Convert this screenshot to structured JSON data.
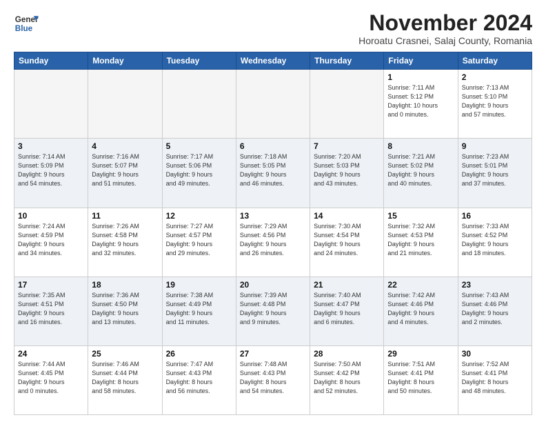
{
  "logo": {
    "line1": "General",
    "line2": "Blue"
  },
  "title": "November 2024",
  "subtitle": "Horoatu Crasnei, Salaj County, Romania",
  "days_of_week": [
    "Sunday",
    "Monday",
    "Tuesday",
    "Wednesday",
    "Thursday",
    "Friday",
    "Saturday"
  ],
  "weeks": [
    [
      {
        "day": "",
        "info": ""
      },
      {
        "day": "",
        "info": ""
      },
      {
        "day": "",
        "info": ""
      },
      {
        "day": "",
        "info": ""
      },
      {
        "day": "",
        "info": ""
      },
      {
        "day": "1",
        "info": "Sunrise: 7:11 AM\nSunset: 5:12 PM\nDaylight: 10 hours\nand 0 minutes."
      },
      {
        "day": "2",
        "info": "Sunrise: 7:13 AM\nSunset: 5:10 PM\nDaylight: 9 hours\nand 57 minutes."
      }
    ],
    [
      {
        "day": "3",
        "info": "Sunrise: 7:14 AM\nSunset: 5:09 PM\nDaylight: 9 hours\nand 54 minutes."
      },
      {
        "day": "4",
        "info": "Sunrise: 7:16 AM\nSunset: 5:07 PM\nDaylight: 9 hours\nand 51 minutes."
      },
      {
        "day": "5",
        "info": "Sunrise: 7:17 AM\nSunset: 5:06 PM\nDaylight: 9 hours\nand 49 minutes."
      },
      {
        "day": "6",
        "info": "Sunrise: 7:18 AM\nSunset: 5:05 PM\nDaylight: 9 hours\nand 46 minutes."
      },
      {
        "day": "7",
        "info": "Sunrise: 7:20 AM\nSunset: 5:03 PM\nDaylight: 9 hours\nand 43 minutes."
      },
      {
        "day": "8",
        "info": "Sunrise: 7:21 AM\nSunset: 5:02 PM\nDaylight: 9 hours\nand 40 minutes."
      },
      {
        "day": "9",
        "info": "Sunrise: 7:23 AM\nSunset: 5:01 PM\nDaylight: 9 hours\nand 37 minutes."
      }
    ],
    [
      {
        "day": "10",
        "info": "Sunrise: 7:24 AM\nSunset: 4:59 PM\nDaylight: 9 hours\nand 34 minutes."
      },
      {
        "day": "11",
        "info": "Sunrise: 7:26 AM\nSunset: 4:58 PM\nDaylight: 9 hours\nand 32 minutes."
      },
      {
        "day": "12",
        "info": "Sunrise: 7:27 AM\nSunset: 4:57 PM\nDaylight: 9 hours\nand 29 minutes."
      },
      {
        "day": "13",
        "info": "Sunrise: 7:29 AM\nSunset: 4:56 PM\nDaylight: 9 hours\nand 26 minutes."
      },
      {
        "day": "14",
        "info": "Sunrise: 7:30 AM\nSunset: 4:54 PM\nDaylight: 9 hours\nand 24 minutes."
      },
      {
        "day": "15",
        "info": "Sunrise: 7:32 AM\nSunset: 4:53 PM\nDaylight: 9 hours\nand 21 minutes."
      },
      {
        "day": "16",
        "info": "Sunrise: 7:33 AM\nSunset: 4:52 PM\nDaylight: 9 hours\nand 18 minutes."
      }
    ],
    [
      {
        "day": "17",
        "info": "Sunrise: 7:35 AM\nSunset: 4:51 PM\nDaylight: 9 hours\nand 16 minutes."
      },
      {
        "day": "18",
        "info": "Sunrise: 7:36 AM\nSunset: 4:50 PM\nDaylight: 9 hours\nand 13 minutes."
      },
      {
        "day": "19",
        "info": "Sunrise: 7:38 AM\nSunset: 4:49 PM\nDaylight: 9 hours\nand 11 minutes."
      },
      {
        "day": "20",
        "info": "Sunrise: 7:39 AM\nSunset: 4:48 PM\nDaylight: 9 hours\nand 9 minutes."
      },
      {
        "day": "21",
        "info": "Sunrise: 7:40 AM\nSunset: 4:47 PM\nDaylight: 9 hours\nand 6 minutes."
      },
      {
        "day": "22",
        "info": "Sunrise: 7:42 AM\nSunset: 4:46 PM\nDaylight: 9 hours\nand 4 minutes."
      },
      {
        "day": "23",
        "info": "Sunrise: 7:43 AM\nSunset: 4:46 PM\nDaylight: 9 hours\nand 2 minutes."
      }
    ],
    [
      {
        "day": "24",
        "info": "Sunrise: 7:44 AM\nSunset: 4:45 PM\nDaylight: 9 hours\nand 0 minutes."
      },
      {
        "day": "25",
        "info": "Sunrise: 7:46 AM\nSunset: 4:44 PM\nDaylight: 8 hours\nand 58 minutes."
      },
      {
        "day": "26",
        "info": "Sunrise: 7:47 AM\nSunset: 4:43 PM\nDaylight: 8 hours\nand 56 minutes."
      },
      {
        "day": "27",
        "info": "Sunrise: 7:48 AM\nSunset: 4:43 PM\nDaylight: 8 hours\nand 54 minutes."
      },
      {
        "day": "28",
        "info": "Sunrise: 7:50 AM\nSunset: 4:42 PM\nDaylight: 8 hours\nand 52 minutes."
      },
      {
        "day": "29",
        "info": "Sunrise: 7:51 AM\nSunset: 4:41 PM\nDaylight: 8 hours\nand 50 minutes."
      },
      {
        "day": "30",
        "info": "Sunrise: 7:52 AM\nSunset: 4:41 PM\nDaylight: 8 hours\nand 48 minutes."
      }
    ]
  ]
}
